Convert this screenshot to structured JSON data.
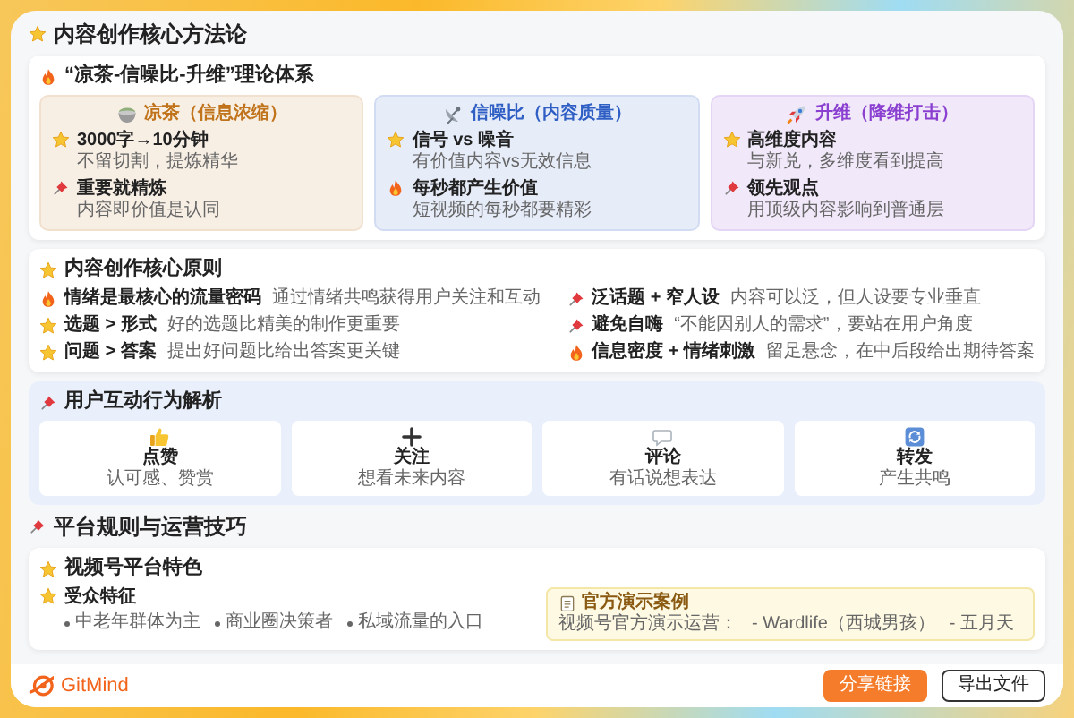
{
  "method_heading": {
    "kind": "star",
    "title": "内容创作核心方法论"
  },
  "theory_card": {
    "kind": "fire",
    "title": "“凉茶-信噪比-升维”理论体系",
    "columns": [
      {
        "kind": "bowl",
        "color": "#c0731a",
        "title": "凉茶（信息浓缩）",
        "items": [
          {
            "kind": "star",
            "title": "3000字→10分钟",
            "text": "不留切割，提炼精华"
          },
          {
            "kind": "pin",
            "title": "重要就精炼",
            "text": "内容即价值是认同"
          }
        ]
      },
      {
        "kind": "satellite",
        "color": "#2f5fc4",
        "title": "信噪比（内容质量）",
        "items": [
          {
            "kind": "star",
            "title": "信号 vs 噪音",
            "text": "有价值内容vs无效信息"
          },
          {
            "kind": "fire",
            "title": "每秒都产生价值",
            "text": "短视频的每秒都要精彩"
          }
        ]
      },
      {
        "kind": "rocket",
        "color": "#8a3fd1",
        "title": "升维（降维打击）",
        "items": [
          {
            "kind": "star",
            "title": "高维度内容",
            "text": "与新兑，多维度看到提高"
          },
          {
            "kind": "pin",
            "title": "领先观点",
            "text": "用顶级内容影响到普通层"
          }
        ]
      }
    ]
  },
  "principles_card": {
    "kind": "star",
    "title": "内容创作核心原则",
    "items": [
      {
        "kind": "fire",
        "title": "情绪是最核心的流量密码",
        "text": "通过情绪共鸣获得用户关注和互动"
      },
      {
        "kind": "pin",
        "title": "泛话题 + 窄人设",
        "text": "内容可以泛，但人设要专业垂直"
      },
      {
        "kind": "star",
        "title": "选题 > 形式",
        "text": "好的选题比精美的制作更重要"
      },
      {
        "kind": "pin",
        "title": "避免自嗨",
        "text": "“不能因别人的需求”，要站在用户角度"
      },
      {
        "kind": "star",
        "title": "问题 > 答案",
        "text": "提出好问题比给出答案更关键"
      },
      {
        "kind": "fire",
        "title": "信息密度 + 情绪刺激",
        "text": "留足悬念，在中后段给出期待答案"
      }
    ]
  },
  "interaction_card": {
    "kind": "pin",
    "title": "用户互动行为解析",
    "items": [
      {
        "kind": "like",
        "label": "点赞",
        "text": "认可感、赞赏"
      },
      {
        "kind": "follow",
        "label": "关注",
        "text": "想看未来内容"
      },
      {
        "kind": "comment",
        "label": "评论",
        "text": "有话说想表达"
      },
      {
        "kind": "share",
        "label": "转发",
        "text": "产生共鸣"
      }
    ]
  },
  "platform_heading": {
    "kind": "pin",
    "title": "平台规则与运营技巧"
  },
  "platform_card": {
    "kind": "star",
    "title": "视频号平台特色",
    "audience": {
      "kind": "star",
      "title": "受众特征",
      "bullets": [
        "中老年群体为主",
        "商业圈决策者",
        "私域流量的入口"
      ]
    },
    "case_box": {
      "title": "官方演示案例",
      "intro": "视频号官方演示运营：",
      "bullets": [
        "- Wardlife（西城男孩）",
        "- 五月天"
      ]
    }
  },
  "footer": {
    "logo": "GitMind",
    "buttons": [
      {
        "kind": "primary",
        "label": "分享链接"
      },
      {
        "kind": "outline",
        "label": "导出文件"
      }
    ]
  }
}
